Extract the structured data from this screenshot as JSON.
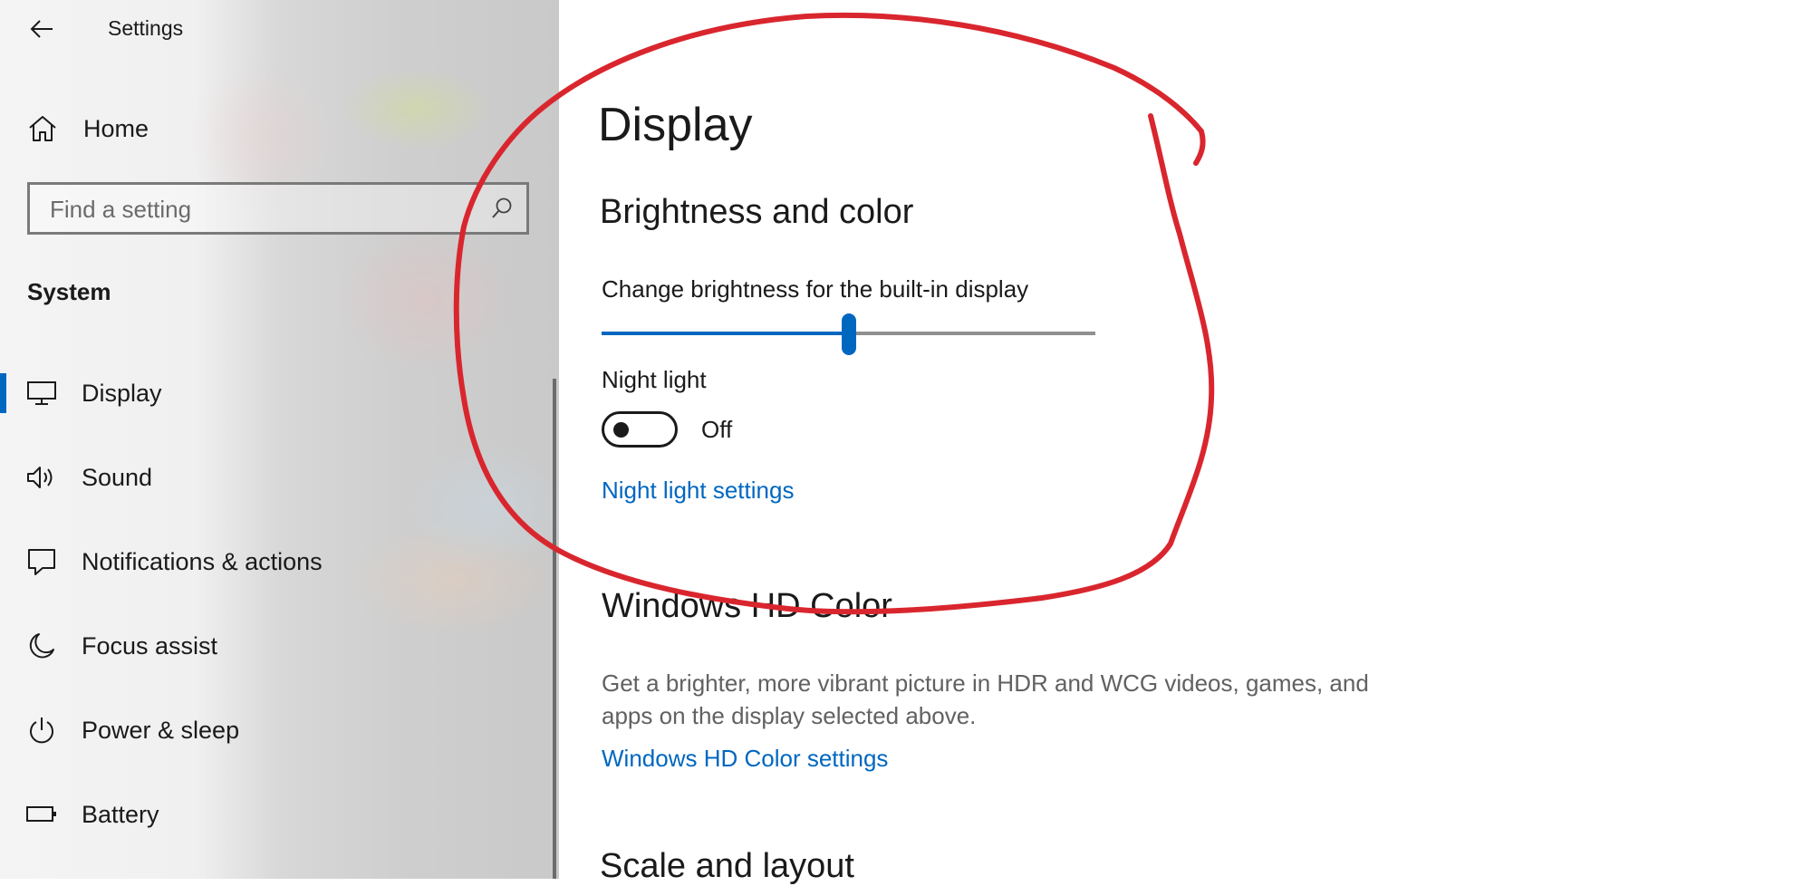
{
  "window": {
    "title": "Settings",
    "back_icon": "back-arrow-icon"
  },
  "sidebar": {
    "home_label": "Home",
    "search": {
      "placeholder": "Find a setting",
      "value": ""
    },
    "section_title": "System",
    "items": [
      {
        "label": "Display",
        "icon": "monitor-icon",
        "selected": true
      },
      {
        "label": "Sound",
        "icon": "speaker-icon",
        "selected": false
      },
      {
        "label": "Notifications & actions",
        "icon": "notification-icon",
        "selected": false
      },
      {
        "label": "Focus assist",
        "icon": "moon-icon",
        "selected": false
      },
      {
        "label": "Power & sleep",
        "icon": "power-icon",
        "selected": false
      },
      {
        "label": "Battery",
        "icon": "battery-icon",
        "selected": false
      }
    ]
  },
  "main": {
    "title": "Display",
    "brightness": {
      "heading": "Brightness and color",
      "slider_label": "Change brightness for the built-in display",
      "slider_value_fraction": 0.5
    },
    "night_light": {
      "label": "Night light",
      "toggle_state": "Off",
      "settings_link": "Night light settings"
    },
    "hd_color": {
      "heading": "Windows HD Color",
      "description": "Get a brighter, more vibrant picture in HDR and WCG videos, games, and apps on the display selected above.",
      "settings_link": "Windows HD Color settings"
    },
    "scale_layout": {
      "heading": "Scale and layout"
    }
  },
  "colors": {
    "accent": "#0067c0",
    "annotation": "#d9262e"
  }
}
